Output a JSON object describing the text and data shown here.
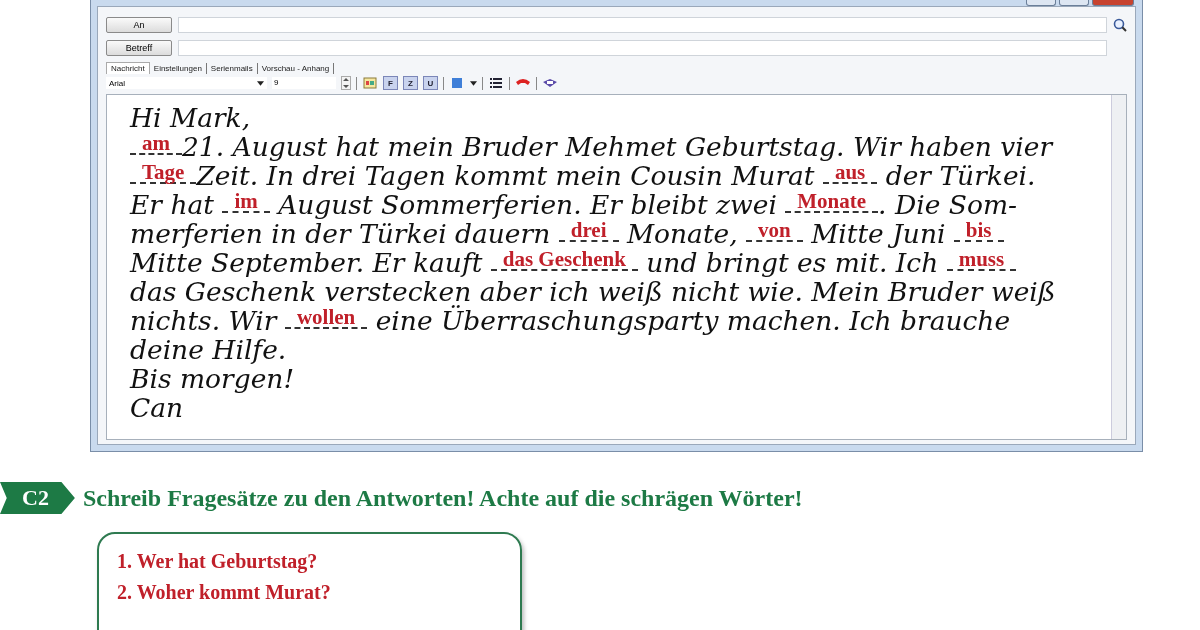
{
  "header": {
    "to_button": "An",
    "subject_button": "Betreff"
  },
  "tabs": [
    {
      "label": "Nachricht",
      "selected": true
    },
    {
      "label": "Einstellungen",
      "selected": false
    },
    {
      "label": "Serienmails",
      "selected": false
    },
    {
      "label": "Vorschau - Anhang",
      "selected": false
    }
  ],
  "toolbar": {
    "font": "Arial",
    "size": "9",
    "format_buttons": [
      "F",
      "Z",
      "U"
    ]
  },
  "message": {
    "lines": [
      [
        {
          "kind": "text",
          "text": "Hi Mark,"
        }
      ],
      [
        {
          "kind": "blank",
          "answer": "am"
        },
        {
          "kind": "text",
          "text": "21. August hat mein Bruder Mehmet Geburtstag. Wir haben vier"
        }
      ],
      [
        {
          "kind": "blank",
          "answer": "Tage"
        },
        {
          "kind": "text",
          "text": "Zeit. In drei Tagen kommt mein Cousin Murat "
        },
        {
          "kind": "blank",
          "answer": "aus"
        },
        {
          "kind": "text",
          "text": " der Türkei."
        }
      ],
      [
        {
          "kind": "text",
          "text": "Er hat "
        },
        {
          "kind": "blank",
          "answer": "im"
        },
        {
          "kind": "text",
          "text": " August Sommerferien. Er bleibt zwei "
        },
        {
          "kind": "blank",
          "answer": "Monate"
        },
        {
          "kind": "text",
          "text": ". Die Som-"
        }
      ],
      [
        {
          "kind": "text",
          "text": "merferien in der Türkei dauern "
        },
        {
          "kind": "blank",
          "answer": "drei"
        },
        {
          "kind": "text",
          "text": " Monate, "
        },
        {
          "kind": "blank",
          "answer": "von"
        },
        {
          "kind": "text",
          "text": " Mitte Juni "
        },
        {
          "kind": "blank",
          "answer": "bis"
        }
      ],
      [
        {
          "kind": "text",
          "text": "Mitte September. Er kauft "
        },
        {
          "kind": "blank",
          "answer": "das Geschenk"
        },
        {
          "kind": "text",
          "text": " und bringt es mit. Ich "
        },
        {
          "kind": "blank",
          "answer": "muss"
        }
      ],
      [
        {
          "kind": "text",
          "text": "das Geschenk verstecken aber ich weiß nicht wie. Mein Bruder weiß"
        }
      ],
      [
        {
          "kind": "text",
          "text": "nichts. Wir "
        },
        {
          "kind": "blank",
          "answer": "wollen"
        },
        {
          "kind": "text",
          "text": " eine Überraschungsparty machen. Ich brauche"
        }
      ],
      [
        {
          "kind": "text",
          "text": "deine Hilfe."
        }
      ],
      [
        {
          "kind": "text",
          "text": "Bis morgen!"
        }
      ],
      [
        {
          "kind": "text",
          "text": "Can"
        }
      ]
    ]
  },
  "exercise": {
    "badge": "C2",
    "instruction": "Schreib Fragesätze zu den Antworten! Achte auf die schrägen Wörter!",
    "answers": [
      "1. Wer hat Geburtstag?",
      "2. Woher kommt Murat?"
    ]
  }
}
